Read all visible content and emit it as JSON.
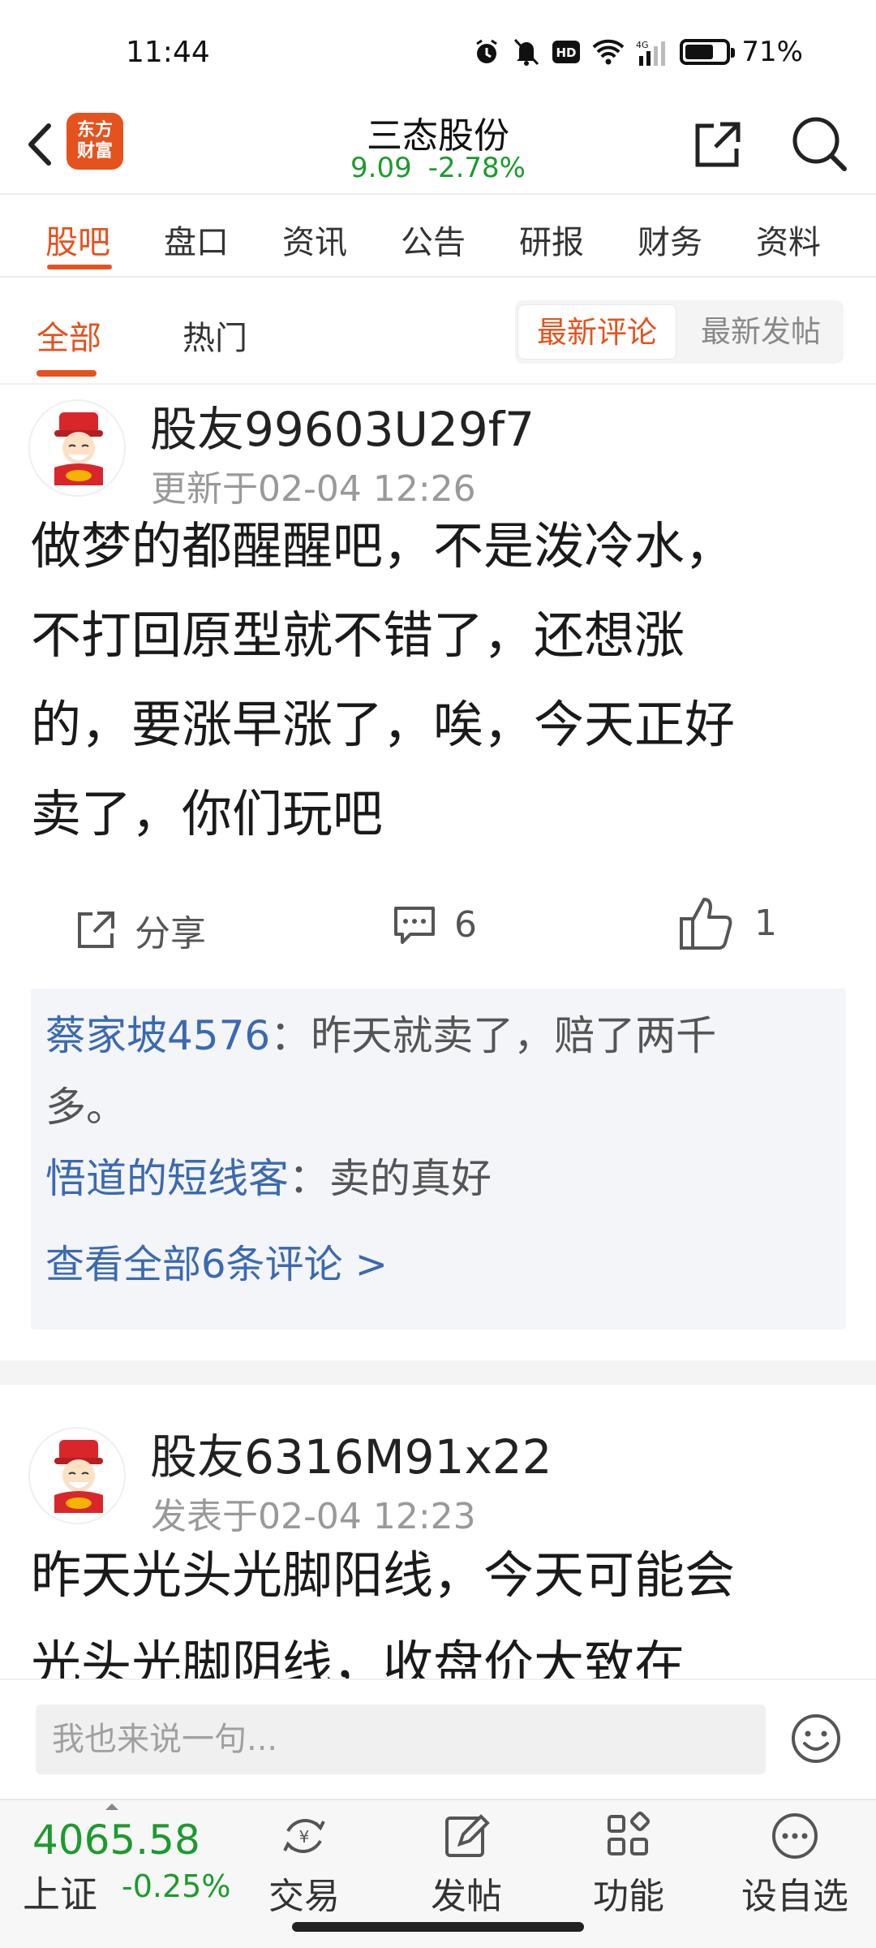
{
  "status_bar": {
    "time": "11:44",
    "battery": "71%",
    "battery_level": 0.71
  },
  "header": {
    "logo_line1": "东方",
    "logo_line2": "财富",
    "stock_name": "三态股份",
    "price": "9.09",
    "change": "-2.78%"
  },
  "tabs": [
    "股吧",
    "盘口",
    "资讯",
    "公告",
    "研报",
    "财务",
    "资料"
  ],
  "subtabs": {
    "all": "全部",
    "hot": "热门",
    "sort_latest_comment": "最新评论",
    "sort_latest_post": "最新发帖"
  },
  "posts": [
    {
      "author": "股友99603U29f7",
      "meta": "更新于02-04 12:26",
      "content_lines": [
        "做梦的都醒醒吧，不是泼冷水，",
        "不打回原型就不错了，还想涨",
        "的，要涨早涨了，唉，今天正好",
        "卖了，你们玩吧"
      ],
      "share_label": "分享",
      "comment_count": "6",
      "like_count": "1",
      "comments": [
        {
          "user": "蔡家坡4576",
          "text_line1": "：昨天就卖了，赔了两千",
          "text_line2": "多。"
        },
        {
          "user": "悟道的短线客",
          "text_line1": "：卖的真好"
        }
      ],
      "view_all": "查看全部6条评论 >"
    },
    {
      "author": "股友6316M91x22",
      "meta": "发表于02-04 12:23",
      "content_lines": [
        "昨天光头光脚阳线，今天可能会",
        "光头光脚阴线，收盘价大致在"
      ]
    }
  ],
  "comment_input": {
    "placeholder": "我也来说一句..."
  },
  "bottom_bar": {
    "index_value": "4065.58",
    "index_name": "上证",
    "index_change": "-0.25%",
    "items": [
      "交易",
      "发帖",
      "功能",
      "设自选"
    ]
  }
}
